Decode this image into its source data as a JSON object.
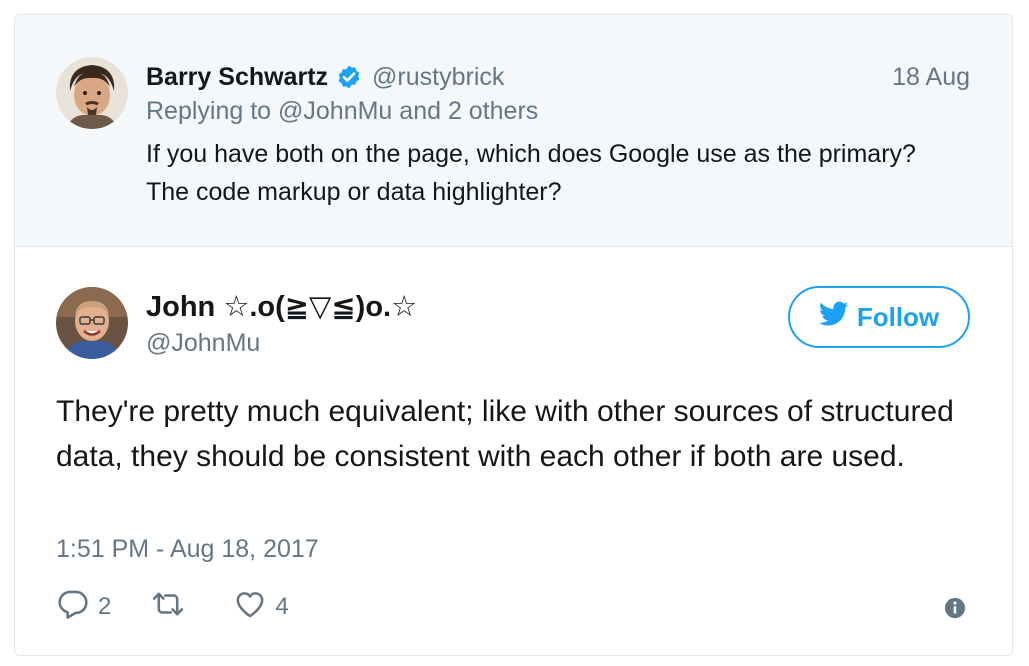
{
  "parent_tweet": {
    "author_name": "Barry Schwartz",
    "author_handle": "@rustybrick",
    "date": "18 Aug",
    "replying_to": "Replying to @JohnMu and 2 others",
    "text": "If you have both on the page, which does Google use as the primary? The code markup or data highlighter?"
  },
  "main_tweet": {
    "author_name": "John ☆.o(≧▽≦)o.☆",
    "author_handle": "@JohnMu",
    "follow_label": "Follow",
    "text": "They're pretty much equivalent; like with other sources of structured data, they should be consistent with each other if both are used.",
    "timestamp": "1:51 PM - Aug 18, 2017",
    "reply_count": "2",
    "like_count": "4"
  },
  "colors": {
    "accent": "#1da1f2",
    "muted_text": "#657786",
    "parent_background": "#f5f8fa",
    "border": "#e1e8ed"
  },
  "icons": [
    "verified-badge-icon",
    "twitter-bird-icon",
    "reply-icon",
    "retweet-icon",
    "like-icon",
    "info-icon"
  ]
}
